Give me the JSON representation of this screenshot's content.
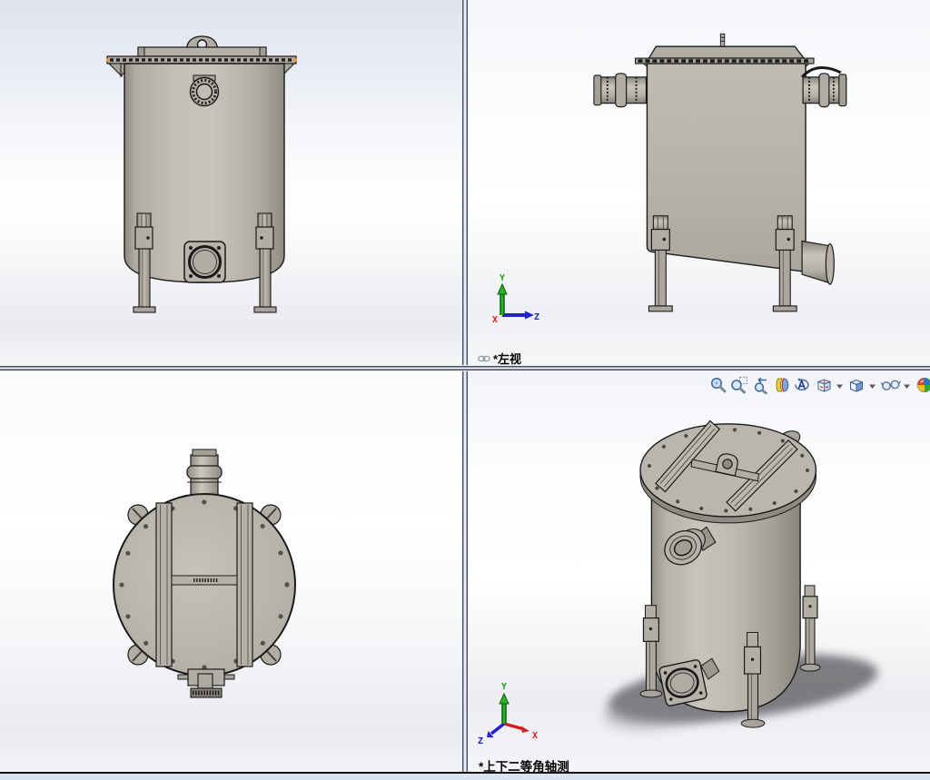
{
  "viewports": {
    "top_right": {
      "label": "*左视"
    },
    "bottom_right": {
      "label": "*上下二等角轴测"
    }
  },
  "triad_left": {
    "x": "X",
    "y": "Y",
    "z": "Z"
  },
  "triad_iso": {
    "x": "X",
    "y": "Y",
    "z": "Z"
  },
  "toolbar": {
    "icons": [
      {
        "name": "zoom-to-fit-icon"
      },
      {
        "name": "zoom-to-area-icon"
      },
      {
        "name": "previous-view-icon"
      },
      {
        "name": "section-view-icon"
      },
      {
        "name": "rotate-view-icon"
      },
      {
        "name": "view-orientation-icon",
        "has_dropdown": true
      },
      {
        "name": "display-style-icon",
        "has_dropdown": true
      },
      {
        "name": "hide-show-items-icon",
        "has_dropdown": true
      },
      {
        "name": "edit-appearance-icon"
      }
    ]
  },
  "colors": {
    "model_fill": "#b3afa6",
    "model_outline": "#191919",
    "axis_x": "#d22020",
    "axis_y": "#1f9a1f",
    "axis_z": "#2222cc",
    "divider": "#4a5068",
    "shadow": "#69696d",
    "selection_dot": "#e79b3a"
  }
}
